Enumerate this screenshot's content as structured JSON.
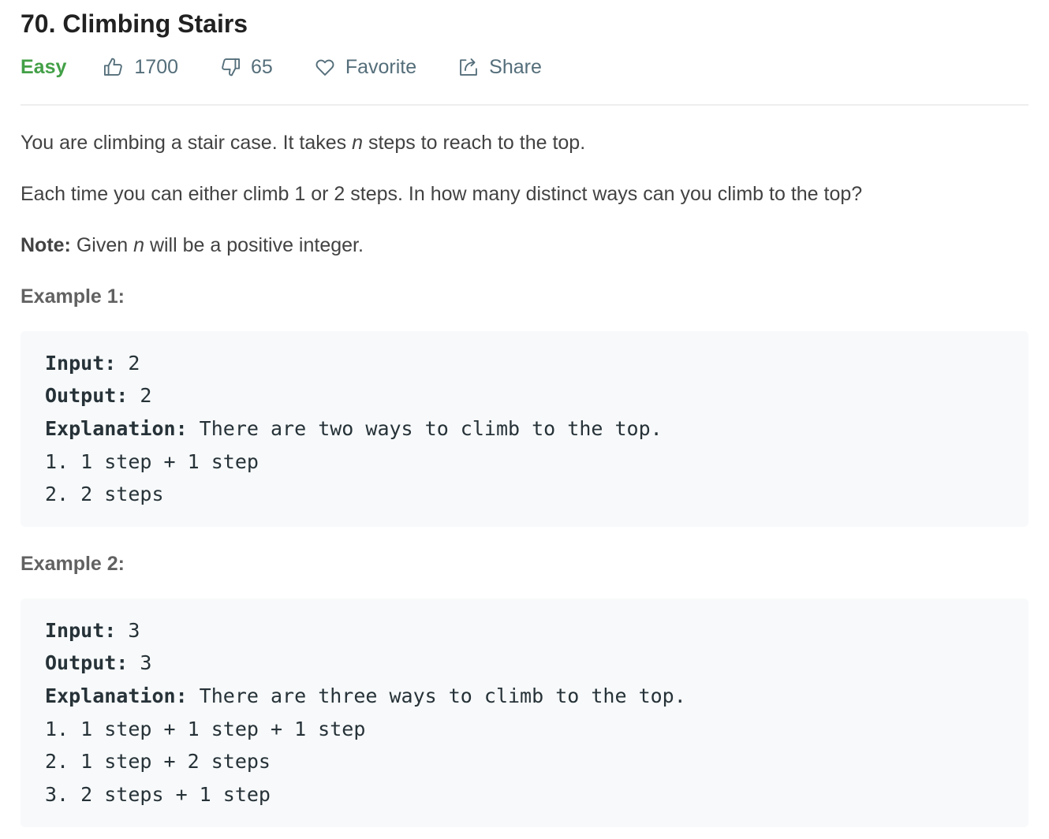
{
  "problem": {
    "title": "70. Climbing Stairs",
    "difficulty": "Easy",
    "likes": "1700",
    "dislikes": "65",
    "favorite_label": "Favorite",
    "share_label": "Share"
  },
  "description": {
    "p1_before": "You are climbing a stair case. It takes ",
    "p1_var": "n",
    "p1_after": " steps to reach to the top.",
    "p2": "Each time you can either climb 1 or 2 steps. In how many distinct ways can you climb to the top?",
    "note_label": "Note:",
    "note_before": " Given ",
    "note_var": "n",
    "note_after": " will be a positive integer."
  },
  "examples": [
    {
      "heading": "Example 1:",
      "input_label": "Input:",
      "input_value": " 2",
      "output_label": "Output:",
      "output_value": " 2",
      "explanation_label": "Explanation:",
      "explanation_value": " There are two ways to climb to the top.",
      "lines": [
        "1. 1 step + 1 step",
        "2. 2 steps"
      ]
    },
    {
      "heading": "Example 2:",
      "input_label": "Input:",
      "input_value": " 3",
      "output_label": "Output:",
      "output_value": " 3",
      "explanation_label": "Explanation:",
      "explanation_value": " There are three ways to climb to the top.",
      "lines": [
        "1. 1 step + 1 step + 1 step",
        "2. 1 step + 2 steps",
        "3. 2 steps + 1 step"
      ]
    }
  ],
  "colors": {
    "easy": "#43a047",
    "meta": "#546e7a",
    "code_bg": "#f7f9fa"
  },
  "icons": {
    "likes": "thumbs-up-icon",
    "dislikes": "thumbs-down-icon",
    "favorite": "heart-icon",
    "share": "share-icon"
  }
}
